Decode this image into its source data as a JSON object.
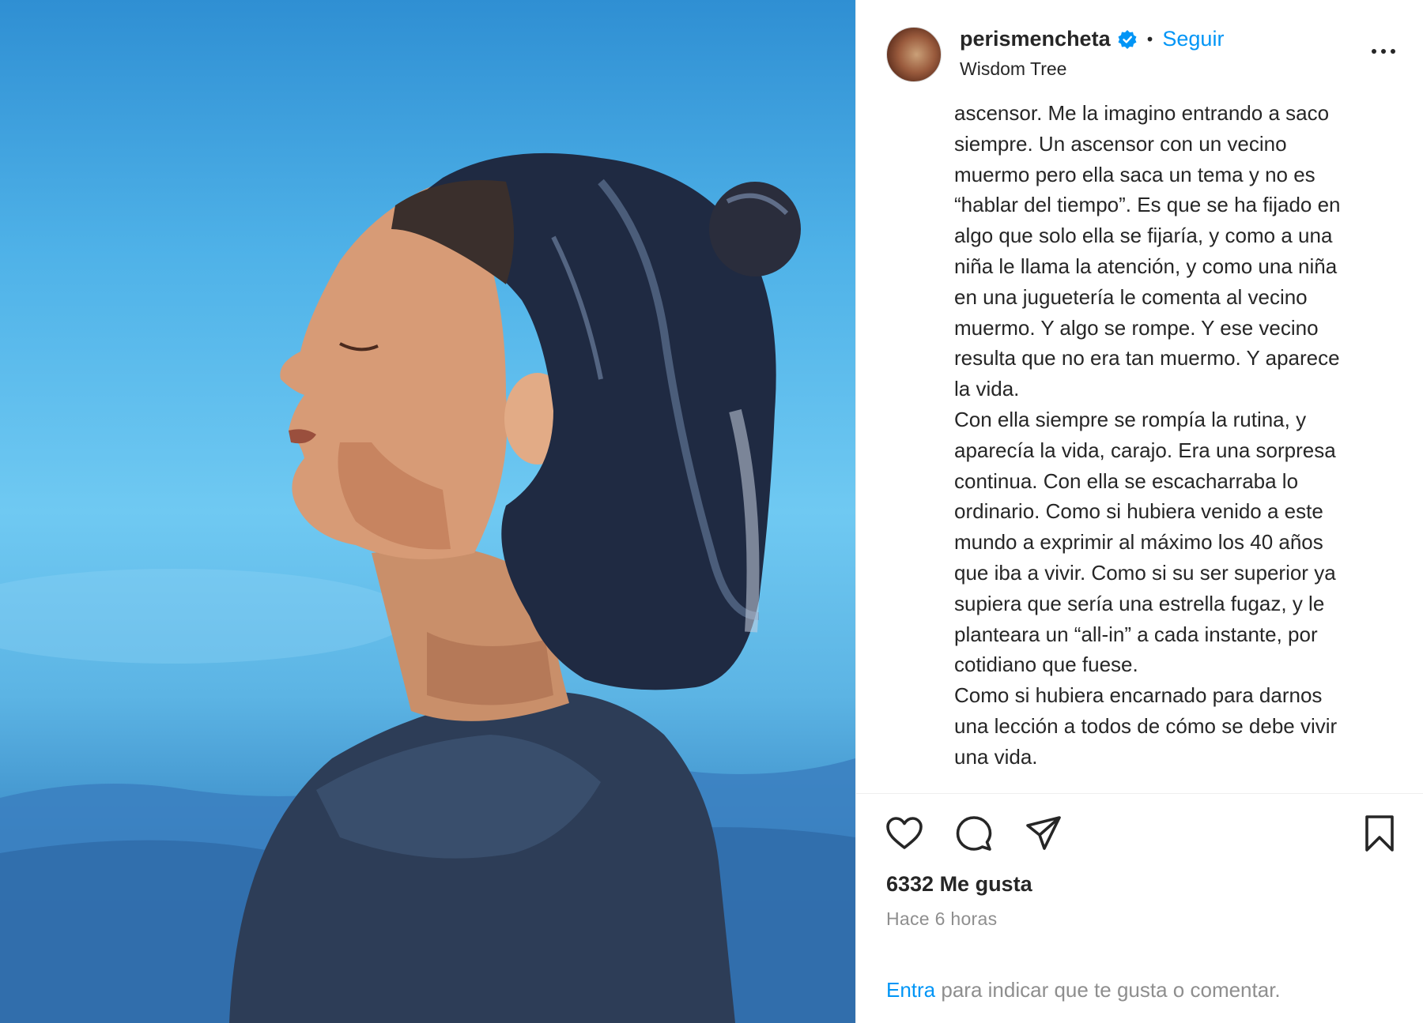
{
  "post": {
    "author": {
      "username": "perismencheta",
      "verified": true,
      "follow_label": "Seguir",
      "separator": "•",
      "location": "Wisdom Tree"
    },
    "caption": "ascensor. Me la imagino entrando a saco\nsiempre. Un ascensor con un vecino\nmuermo pero ella saca un tema y no es\n“hablar del tiempo”. Es que se ha fijado en\nalgo que solo ella se fijaría, y como a una\nniña le llama la atención, y como una niña\nen una juguetería le comenta al vecino\nmuermo. Y algo se rompe. Y ese vecino\nresulta que no era tan muermo. Y aparece\nla vida.\nCon ella siempre se rompía la rutina, y\naparecía la vida, carajo. Era una sorpresa\ncontinua. Con ella se escacharraba lo\nordinario. Como si hubiera venido a este\nmundo a exprimir al máximo los 40 años\nque iba a vivir. Como si su ser superior ya\nsupiera que sería una estrella fugaz, y le\nplanteara un “all-in” a cada instante, por\ncotidiano que fuese.\nComo si hubiera encarnado para darnos\nuna lección a todos de cómo se debe vivir\nuna vida.",
    "likes": "6332 Me gusta",
    "timestamp": "Hace 6 horas",
    "login_prompt": {
      "link": "Entra",
      "rest": " para indicar que te gusta o comentar."
    }
  },
  "icons": {
    "verified": "verified-badge-icon",
    "more": "more-options-icon",
    "like": "heart-icon",
    "comment": "comment-icon",
    "share": "share-icon",
    "save": "bookmark-icon"
  },
  "colors": {
    "accent": "#0095f6",
    "text": "#262626",
    "muted": "#8e8e8e"
  }
}
